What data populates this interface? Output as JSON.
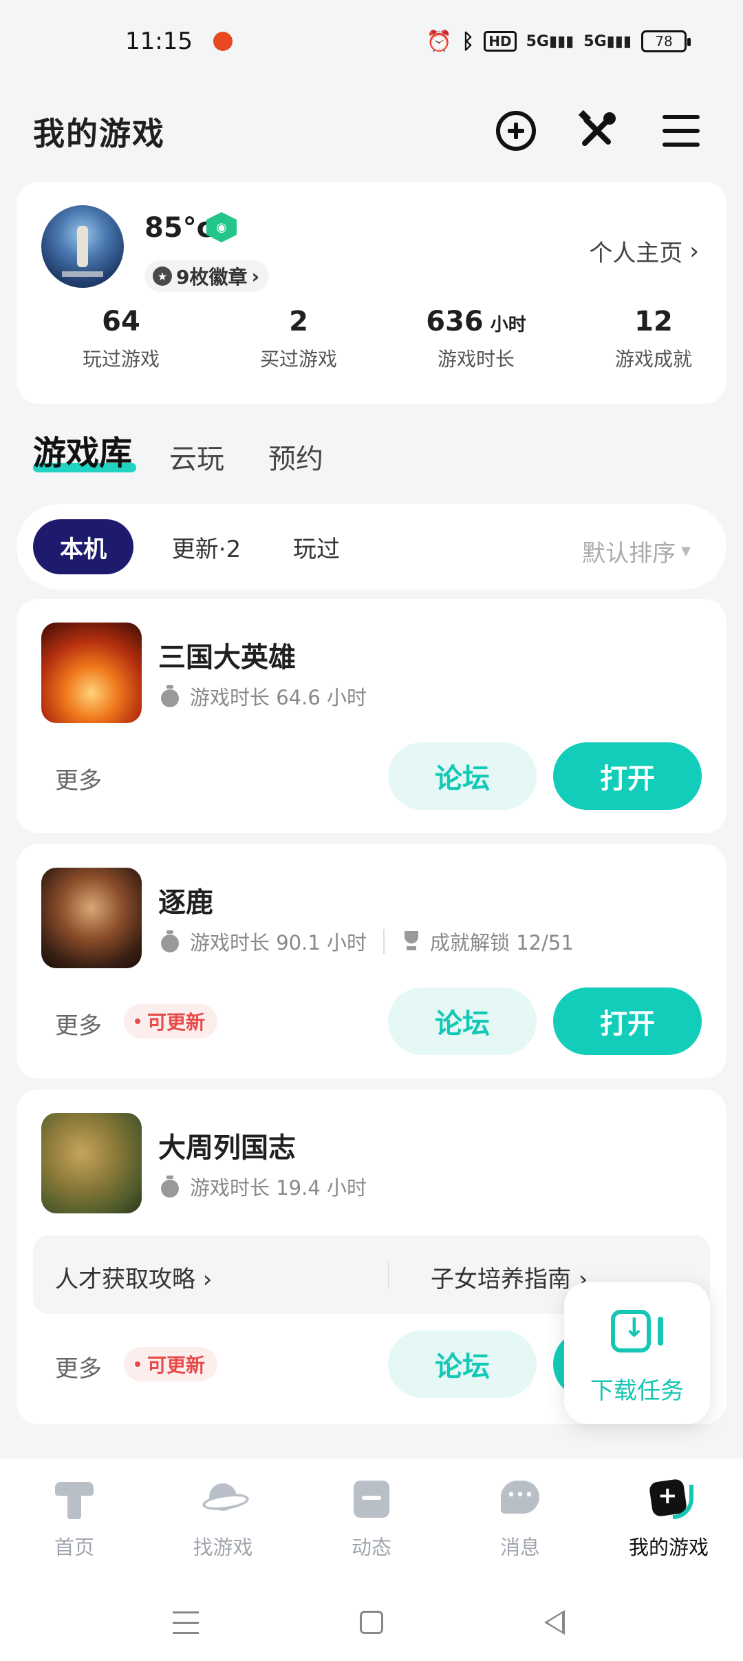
{
  "status_bar": {
    "time": "11:15",
    "icons": [
      "alarm-icon",
      "bluetooth-icon",
      "hd-icon",
      "5g-signal-icon",
      "5g-signal-icon"
    ],
    "hd_label": "HD",
    "net1": "5G",
    "net2": "5G",
    "battery": "78"
  },
  "header": {
    "title": "我的游戏",
    "icons": [
      "add-circle-icon",
      "tools-icon",
      "menu-icon"
    ]
  },
  "profile": {
    "username": "85°c",
    "badges_label": "9枚徽章",
    "home_link": "个人主页",
    "stats": [
      {
        "value": "64",
        "unit": "",
        "label": "玩过游戏"
      },
      {
        "value": "2",
        "unit": "",
        "label": "买过游戏"
      },
      {
        "value": "636",
        "unit": "小时",
        "label": "游戏时长"
      },
      {
        "value": "12",
        "unit": "",
        "label": "游戏成就"
      }
    ]
  },
  "main_tabs": [
    {
      "label": "游戏库",
      "active": true
    },
    {
      "label": "云玩",
      "active": false
    },
    {
      "label": "预约",
      "active": false
    }
  ],
  "filters": {
    "chips": [
      {
        "label": "本机",
        "active": true
      },
      {
        "label": "更新·2",
        "active": false
      },
      {
        "label": "玩过",
        "active": false
      }
    ],
    "sort_label": "默认排序"
  },
  "games": [
    {
      "name": "三国大英雄",
      "playtime": "游戏时长 64.6 小时",
      "achievement": "",
      "more": "更多",
      "update_tag": "",
      "forum": "论坛",
      "open": "打开"
    },
    {
      "name": "逐鹿",
      "playtime": "游戏时长 90.1 小时",
      "achievement": "成就解锁 12/51",
      "more": "更多",
      "update_tag": "可更新",
      "forum": "论坛",
      "open": "打开"
    },
    {
      "name": "大周列国志",
      "playtime": "游戏时长 19.4 小时",
      "achievement": "",
      "guides": [
        "人才获取攻略",
        "子女培养指南"
      ],
      "more": "更多",
      "update_tag": "可更新",
      "forum": "论坛",
      "open": "打开"
    }
  ],
  "floating": {
    "download_label": "下载任务"
  },
  "bottom_nav": [
    {
      "label": "首页",
      "icon": "home-icon",
      "active": false
    },
    {
      "label": "找游戏",
      "icon": "planet-icon",
      "active": false
    },
    {
      "label": "动态",
      "icon": "feed-icon",
      "active": false
    },
    {
      "label": "消息",
      "icon": "message-icon",
      "active": false
    },
    {
      "label": "我的游戏",
      "icon": "my-games-icon",
      "active": true
    }
  ],
  "colors": {
    "accent": "#12cdb9",
    "active_chip": "#1e1b6f",
    "update_red": "#e84a4a",
    "background": "#f4f5f7"
  }
}
